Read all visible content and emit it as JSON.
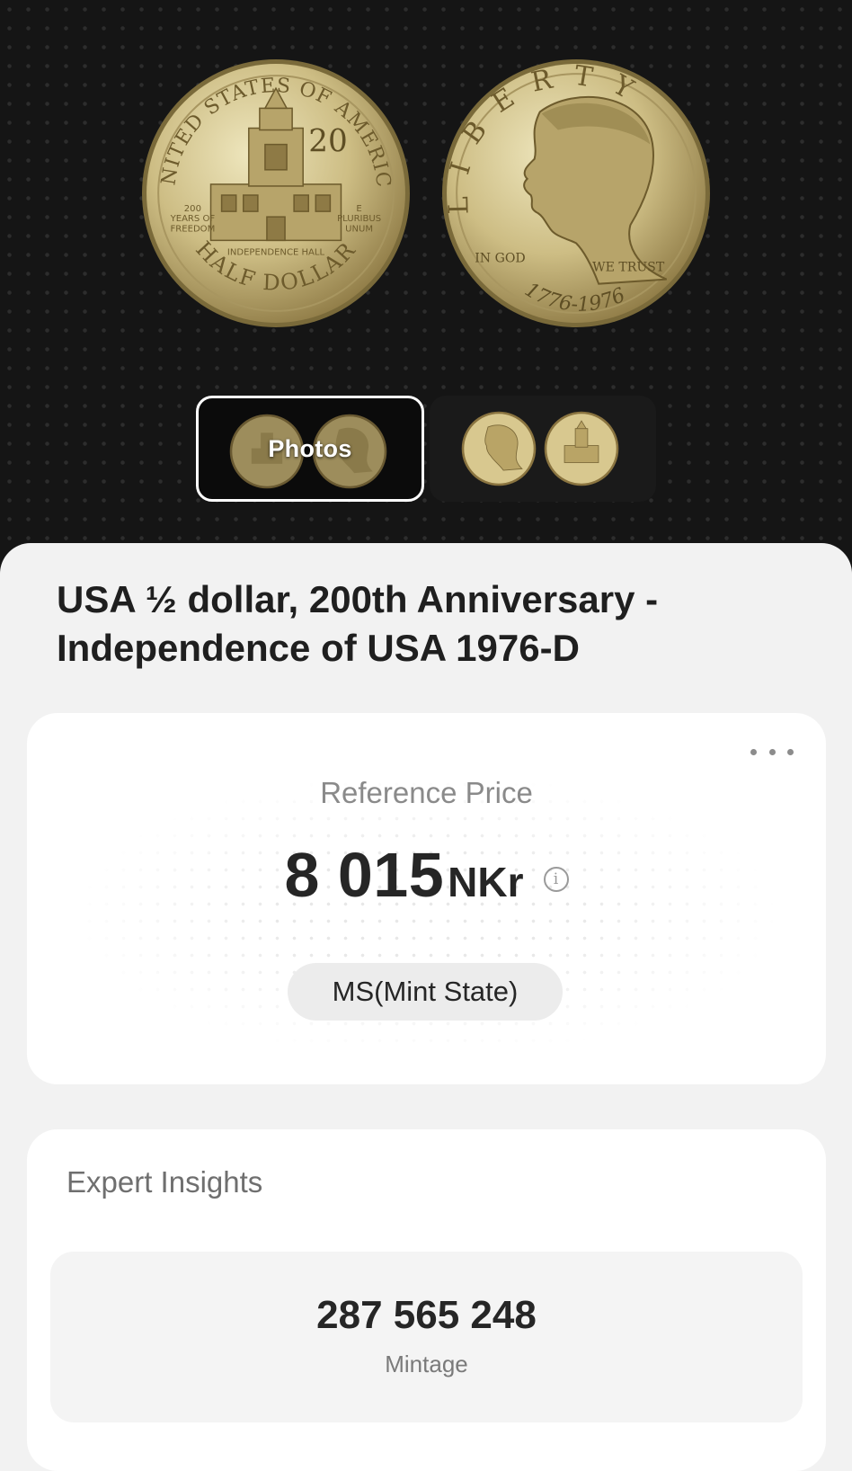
{
  "hero": {
    "reverse_coin_text": {
      "rim_top": "UNITED STATES OF AMERICA",
      "rim_bottom": "HALF DOLLAR",
      "left_legend_1": "200",
      "left_legend_2": "YEARS OF",
      "left_legend_3": "FREEDOM",
      "right_legend_1": "E",
      "right_legend_2": "PLURIBUS",
      "right_legend_3": "UNUM",
      "building_label": "INDEPENDENCE HALL"
    },
    "obverse_coin_text": {
      "rim": "LIBERTY",
      "motto_left": "IN GOD",
      "motto_right": "WE TRUST",
      "dates": "1776-1976"
    },
    "thumbnails": {
      "photos_label": "Photos"
    },
    "colors": {
      "coin_light": "#e6dcae",
      "coin_mid": "#c8b67a",
      "coin_dark": "#8e7a45"
    }
  },
  "coin": {
    "title": "USA ½ dollar, 200th Anniversary - Independence of USA 1976-D"
  },
  "price_card": {
    "more_icon": "ellipsis-icon",
    "label": "Reference Price",
    "value": "8 015",
    "currency": "NKr",
    "info_icon": "info-icon",
    "grade": "MS(Mint State)"
  },
  "insights": {
    "title": "Expert Insights",
    "stat": {
      "value": "287 565 248",
      "label": "Mintage"
    }
  }
}
